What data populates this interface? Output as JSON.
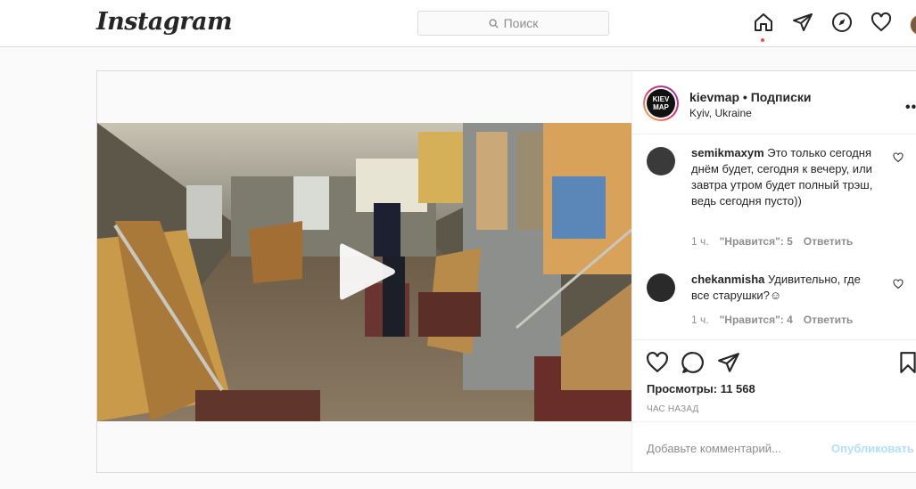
{
  "topbar": {
    "logo": "Instagram",
    "search_placeholder": "Поиск"
  },
  "post": {
    "username": "kievmap",
    "follow_separator": " • ",
    "follow_label": "Подписки",
    "location": "Kyiv, Ukraine",
    "avatar_text": "KIEV MAP",
    "more": "•••",
    "comments": [
      {
        "user": "semikmaxym",
        "text": "Это только сегодня днём будет, сегодня к вечеру, или завтра утром будет полный трэш, ведь сегодня пусто))",
        "time": "1 ч.",
        "likes": "\"Нравится\": 5",
        "reply": "Ответить"
      },
      {
        "user": "chekanmisha",
        "text": "Удивительно, где все старушки?☺",
        "time": "1 ч.",
        "likes": "\"Нравится\": 4",
        "reply": "Ответить"
      }
    ],
    "views": "Просмотры: 11 568",
    "posted": "ЧАС НАЗАД",
    "comment_placeholder": "Добавьте комментарий...",
    "publish": "Опубликовать"
  },
  "colors": {
    "accent_disabled": "#b2dffc",
    "notification_dot": "#ed4956",
    "border": "#dbdbdb"
  },
  "icons": [
    "search-icon",
    "home-icon",
    "direct-icon",
    "explore-icon",
    "activity-heart-icon",
    "play-icon",
    "like-icon",
    "comment-icon",
    "share-icon",
    "save-icon"
  ]
}
